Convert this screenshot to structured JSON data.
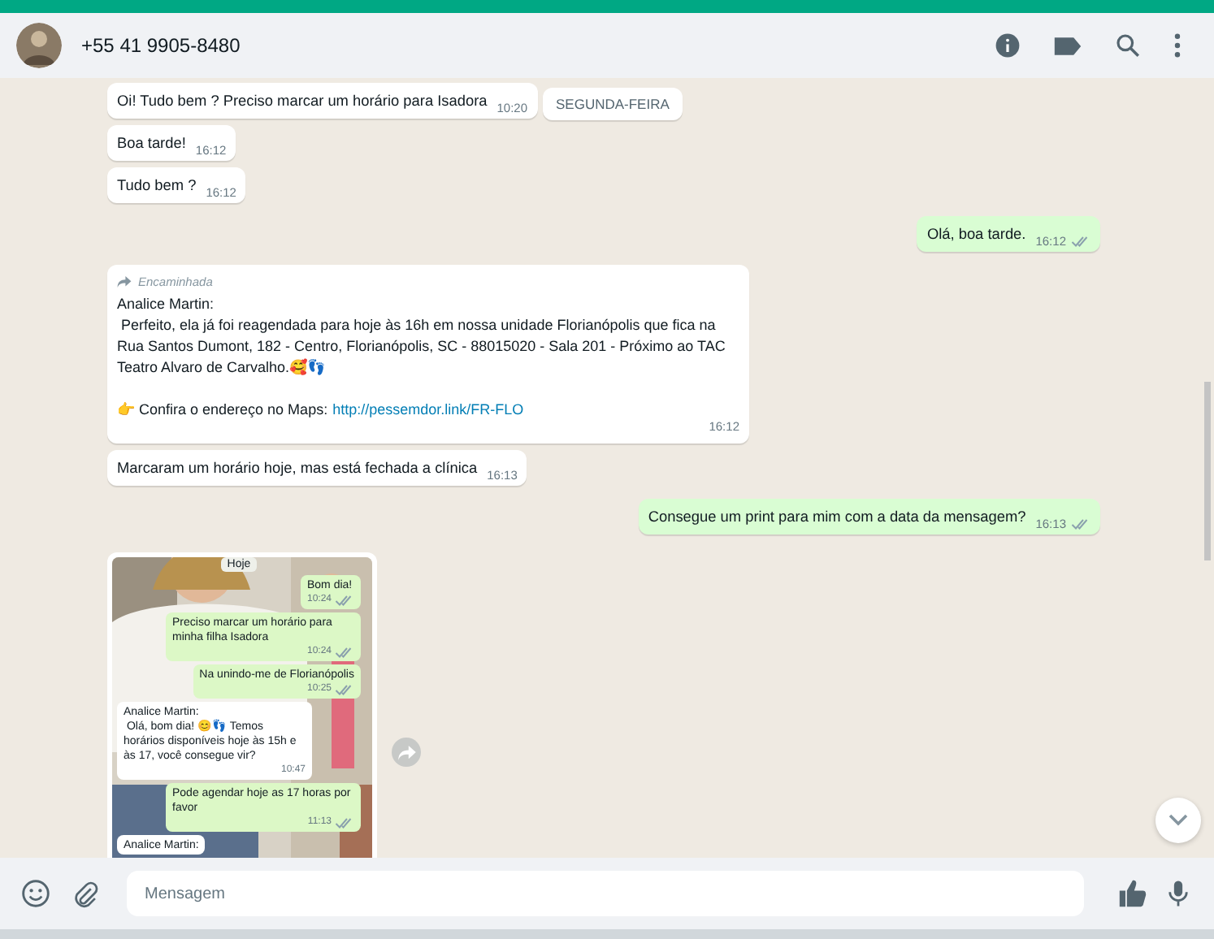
{
  "header": {
    "title": "+55 41 9905-8480"
  },
  "date_label": "SEGUNDA-FEIRA",
  "messages": [
    {
      "kind": "text",
      "outgoing": false,
      "text": "Oi! Tudo bem ? Preciso marcar um horário para Isadora",
      "time": "10:20"
    },
    {
      "kind": "text",
      "outgoing": false,
      "text": "Boa tarde!",
      "time": "16:12"
    },
    {
      "kind": "text",
      "outgoing": false,
      "text": "Tudo bem ?",
      "time": "16:12"
    },
    {
      "kind": "text",
      "outgoing": true,
      "text": "Olá, boa tarde.",
      "time": "16:12",
      "read": true
    },
    {
      "kind": "forwarded",
      "forwarded_label": "Encaminhada",
      "sender": "Analice Martin:",
      "text": " Perfeito, ela já foi reagendada para hoje às 16h em nossa unidade Florianópolis que fica na Rua Santos Dumont, 182 - Centro, Florianópolis, SC - 88015020 - Sala 201 - Próximo ao TAC Teatro Alvaro de Carvalho.🥰👣",
      "link_prefix": "👉 Confira o endereço no Maps:",
      "link": "http://pessemdor.link/FR-FLO",
      "time": "16:12"
    },
    {
      "kind": "text",
      "outgoing": false,
      "text": "Marcaram um horário hoje, mas está fechada a clínica",
      "time": "16:13"
    },
    {
      "kind": "text",
      "outgoing": true,
      "text": "Consegue um print para mim com a data da mensagem?",
      "time": "16:13",
      "read": true
    },
    {
      "screenshot": {
        "date_label": "Hoje",
        "bubbles": [
          {
            "outgoing": true,
            "text": "Bom dia!",
            "time": "10:24",
            "read": true
          },
          {
            "outgoing": true,
            "text": "Preciso marcar um horário para minha filha Isadora",
            "time": "10:24",
            "read": true
          },
          {
            "outgoing": true,
            "text": "Na unindo-me de Florianópolis",
            "time": "10:25",
            "read": true
          },
          {
            "outgoing": false,
            "sender": "Analice Martin:",
            "text": " Olá, bom dia! 😊👣 Temos horários disponíveis hoje às 15h e às 17, você consegue vir?",
            "time": "10:47"
          },
          {
            "outgoing": true,
            "text": "Pode agendar hoje as 17 horas por favor",
            "time": "11:13",
            "read": true
          },
          {
            "outgoing": false,
            "sender": "Analice Martin:"
          }
        ]
      }
    }
  ],
  "composer": {
    "placeholder": "Mensagem"
  }
}
